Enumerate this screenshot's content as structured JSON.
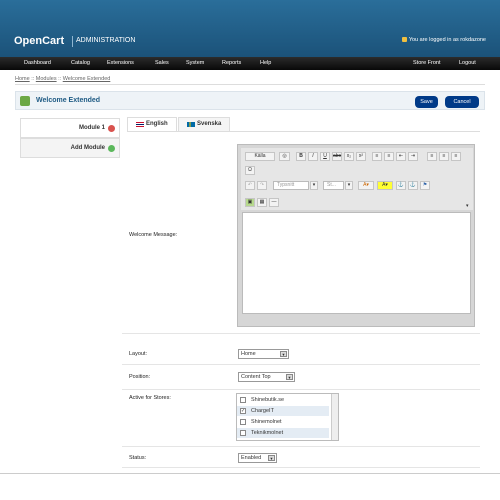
{
  "header": {
    "logo": "OpenCart",
    "subtitle": "ADMINISTRATION",
    "login_text": "You are logged in as rokdazone"
  },
  "menu": {
    "items": [
      "Dashboard",
      "Catalog",
      "Extensions",
      "Sales",
      "System",
      "Reports",
      "Help"
    ],
    "store_front": "Store Front",
    "logout": "Logout"
  },
  "breadcrumb": {
    "items": [
      "Home",
      "Modules",
      "Welcome Extended"
    ],
    "separator": "::"
  },
  "page": {
    "title": "Welcome Extended",
    "save_label": "Save",
    "cancel_label": "Cancel"
  },
  "modules": {
    "module_label": "Module 1",
    "add_label": "Add Module"
  },
  "languages": {
    "tabs": [
      "English",
      "Svenska"
    ]
  },
  "editor": {
    "label": "Welcome Message:",
    "source_label": "Källa",
    "format_placeholder": "Typsnitt",
    "size_placeholder": "St..."
  },
  "form": {
    "layout_label": "Layout:",
    "layout_value": "Home",
    "position_label": "Position:",
    "position_value": "Content Top",
    "stores_label": "Active for Stores:",
    "stores": [
      {
        "name": "Shinebutik.se",
        "checked": false
      },
      {
        "name": "ChargeIT",
        "checked": true
      },
      {
        "name": "Shinemolnet",
        "checked": false
      },
      {
        "name": "Teknikmolnet",
        "checked": false
      }
    ],
    "status_label": "Status:",
    "status_value": "Enabled"
  },
  "colors": {
    "header_blue": "#1f5b84",
    "menu_black": "#111111",
    "button_blue": "#003a88",
    "remove_red": "#d9534f",
    "add_green": "#5cb85c"
  }
}
